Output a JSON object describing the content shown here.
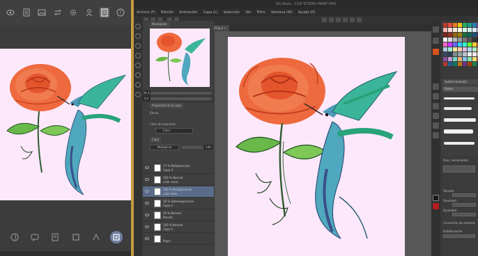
{
  "tablet_app": {
    "top_icons": [
      "back-icon",
      "document-icon",
      "gallery-icon",
      "swap-icon",
      "settings-icon",
      "person-icon",
      "layer-panel-icon",
      "help-icon"
    ],
    "help_glyph": "?",
    "bottom_icons": [
      "lasso-icon",
      "chat-icon",
      "notebook-icon",
      "square-icon",
      "text-icon",
      "layers-icon"
    ]
  },
  "desktop_app": {
    "window_title": "Sin título - CLIP STUDIO PAINT PRO",
    "menu": [
      "Archivo (F)",
      "Edición",
      "Animación",
      "Capa (L)",
      "Selección",
      "Ver",
      "Filtro",
      "Ventana (W)",
      "Ayuda (H)"
    ],
    "canvas_tab": "Sin título (1080 x 1350px) ×",
    "panels": {
      "navigator_tab": "Navegador",
      "zoom_value": "34,4",
      "rotation_value": "0,0",
      "properties_tab": "Propiedad de la capa",
      "effect_label": "Efecto",
      "expression_label": "Color de expresión",
      "expression_value": "Color",
      "layer_tab": "Capa",
      "blend_mode": "Multiplicar",
      "opacity_value": "100"
    },
    "layers": [
      {
        "line1": "17 % Multiplicación",
        "line2": "Capa 3"
      },
      {
        "line1": "100 % Normal",
        "line2": "color rosas"
      },
      {
        "line1": "100 % Multiplicación",
        "line2": "color base",
        "selected": true
      },
      {
        "line1": "36 % Sobreexposición",
        "line2": "Capa 2"
      },
      {
        "line1": "50 % Normal",
        "line2": "Boceto"
      },
      {
        "line1": "100 % Normal",
        "line2": "Capa 2"
      },
      {
        "line1": "",
        "line2": "Papel"
      }
    ],
    "brush_panel": {
      "title": "Subherramienta",
      "group": "Gama"
    },
    "tool_props": {
      "title": "Prop. herramienta",
      "brush_size_label": "Tamaño",
      "density_label": "Densidad",
      "opacity_label": "Opacidad",
      "stabilization_label": "Estabilización",
      "smoothing_label": "Corrección de vectores"
    },
    "palette": [
      "#c0392b",
      "#e74c3c",
      "#e67e22",
      "#f1c40f",
      "#27ae60",
      "#16a085",
      "#2980b9",
      "#8e44ad",
      "#f5b7b1",
      "#fadbd8",
      "#fdebd0",
      "#fef9e7",
      "#d5f5e3",
      "#d0ece7",
      "#d6eaf8",
      "#e8daef",
      "#7b241c",
      "#943126",
      "#9c640c",
      "#9a7d0a",
      "#196f3d",
      "#0e6655",
      "#1a5276",
      "#5b2c6f",
      "#ffffff",
      "#dddddd",
      "#bbbbbb",
      "#999999",
      "#777777",
      "#555555",
      "#333333",
      "#000000",
      "#ff66cc",
      "#cc33ff",
      "#6666ff",
      "#33ccff",
      "#33ffcc",
      "#66ff33",
      "#ffcc33",
      "#ff6633",
      "#a9cce3",
      "#a3e4d7",
      "#f9e79f",
      "#f5cba7",
      "#d7bde2",
      "#aed6f1",
      "#abebc6",
      "#f8c471",
      "#34495e",
      "#2c3e50",
      "#7f8c8d",
      "#95a5a6",
      "#bdc3c7",
      "#ecf0f1",
      "#ffe6f2",
      "#e6ffe6",
      "#884ea0",
      "#c39bd3",
      "#76d7c4",
      "#f0b27a",
      "#85c1e9",
      "#82e0aa",
      "#f7dc6f",
      "#ec7063",
      "#b03a2e",
      "#1f618d",
      "#117864",
      "#b9770e",
      "#6c3483",
      "#a04000",
      "#1d8348",
      "#283747"
    ]
  }
}
